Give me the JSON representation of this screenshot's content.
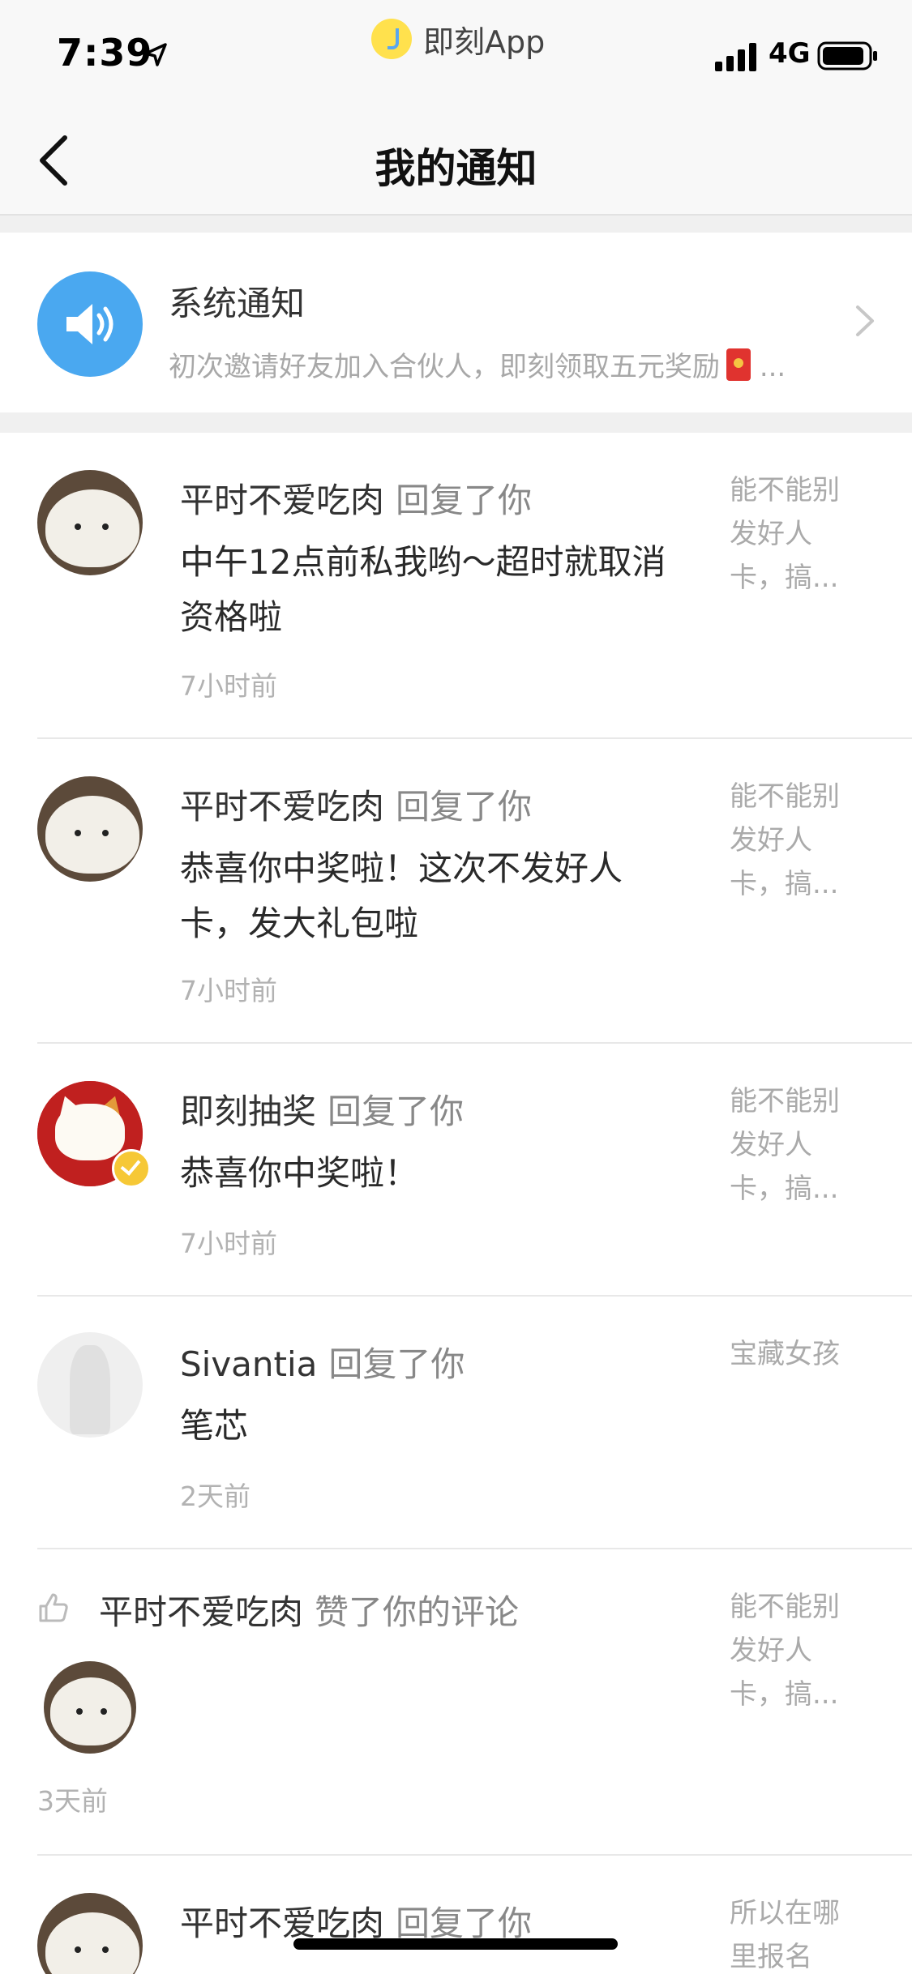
{
  "status_bar": {
    "time": "7:39",
    "app_name": "即刻App",
    "network": "4G"
  },
  "nav": {
    "title": "我的通知"
  },
  "system_notice": {
    "title": "系统通知",
    "preview": "初次邀请好友加入合伙人，即刻领取五元奖励",
    "ellipsis": "..."
  },
  "notifications": [
    {
      "user": "平时不爱吃肉",
      "action": "回复了你",
      "message": "中午12点前私我哟～超时就取消资格啦",
      "time": "7小时前",
      "context": "能不能别发好人卡，搞..."
    },
    {
      "user": "平时不爱吃肉",
      "action": "回复了你",
      "message": "恭喜你中奖啦！这次不发好人卡，发大礼包啦",
      "time": "7小时前",
      "context": "能不能别发好人卡，搞..."
    },
    {
      "user": "即刻抽奖",
      "action": "回复了你",
      "message": "恭喜你中奖啦！",
      "time": "7小时前",
      "context": "能不能别发好人卡，搞..."
    },
    {
      "user": "Sivantia",
      "action": "回复了你",
      "message": "笔芯",
      "time": "2天前",
      "context": "宝藏女孩"
    },
    {
      "user": "平时不爱吃肉",
      "action": "赞了你的评论",
      "time": "3天前",
      "context": "能不能别发好人卡，搞..."
    },
    {
      "user": "平时不爱吃肉",
      "action": "回复了你",
      "context": "所以在哪里报名"
    }
  ],
  "icons": {
    "back": "chevron-left-icon",
    "location": "location-arrow-icon",
    "signal": "signal-bars-icon",
    "battery": "battery-icon",
    "speaker": "speaker-icon",
    "like": "thumbs-up-icon"
  },
  "colors": {
    "accent_blue": "#4aa8f0",
    "badge_yellow": "#f6c836",
    "envelope_red": "#e0332f"
  }
}
